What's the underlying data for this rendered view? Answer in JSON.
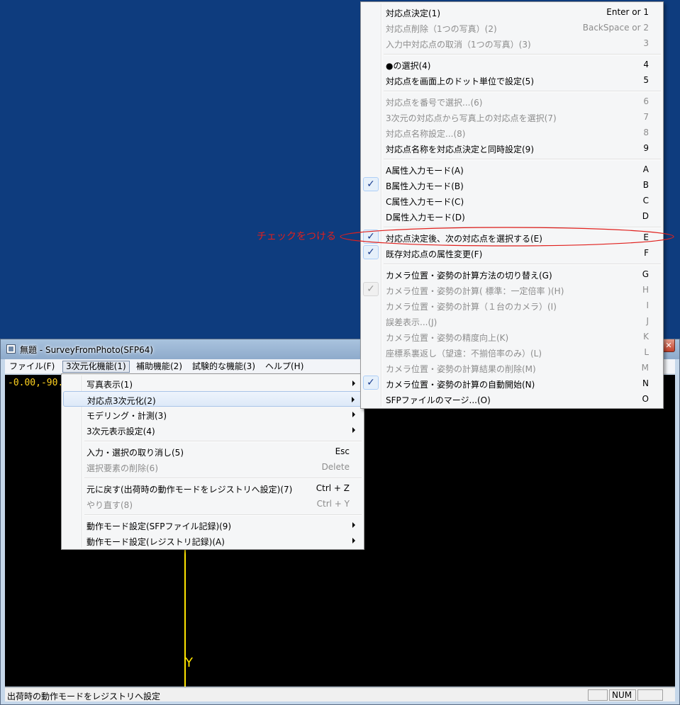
{
  "window": {
    "title": "無題 - SurveyFromPhoto(SFP64)",
    "close_label": "✕"
  },
  "menubar": {
    "items": [
      {
        "label": "ファイル(F)"
      },
      {
        "label": "3次元化機能(1)"
      },
      {
        "label": "補助機能(2)"
      },
      {
        "label": "試験的な機能(3)"
      },
      {
        "label": "ヘルプ(H)"
      }
    ]
  },
  "canvas": {
    "coord_readout": "-0.00,-90.",
    "axis_label": "Y",
    "line_color": "#ffe400"
  },
  "statusbar": {
    "text": "出荷時の動作モードをレジストリへ設定",
    "num_label": "NUM"
  },
  "main_menu": {
    "items": [
      {
        "label": "写真表示(1)",
        "submenu": true
      },
      {
        "label": "対応点3次元化(2)",
        "submenu": true
      },
      {
        "label": "モデリング・計測(3)",
        "submenu": true
      },
      {
        "label": "3次元表示設定(4)",
        "submenu": true
      },
      {
        "label": "入力・選択の取り消し(5)",
        "shortcut": "Esc"
      },
      {
        "label": "選択要素の削除(6)",
        "shortcut": "Delete"
      },
      {
        "label": "元に戻す(出荷時の動作モードをレジストリへ設定)(7)",
        "shortcut": "Ctrl + Z"
      },
      {
        "label": "やり直す(8)",
        "shortcut": "Ctrl + Y"
      },
      {
        "label": "動作モード設定(SFPファイル記録)(9)",
        "submenu": true
      },
      {
        "label": "動作モード設定(レジストリ記録)(A)",
        "submenu": true
      }
    ]
  },
  "sub_menu": {
    "items": [
      {
        "label": "対応点決定(1)",
        "shortcut": "Enter or 1"
      },
      {
        "label": "対応点削除（1つの写真）(2)",
        "shortcut": "BackSpace or 2"
      },
      {
        "label": "入力中対応点の取消（1つの写真）(3)",
        "shortcut": "3"
      },
      {
        "label": "●の選択(4)",
        "shortcut": "4"
      },
      {
        "label": "対応点を画面上のドット単位で設定(5)",
        "shortcut": "5"
      },
      {
        "label": "対応点を番号で選択...(6)",
        "shortcut": "6"
      },
      {
        "label": "3次元の対応点から写真上の対応点を選択(7)",
        "shortcut": "7"
      },
      {
        "label": "対応点名称設定...(8)",
        "shortcut": "8"
      },
      {
        "label": "対応点名称を対応点決定と同時設定(9)",
        "shortcut": "9"
      },
      {
        "label": "A属性入力モード(A)",
        "shortcut": "A"
      },
      {
        "label": "B属性入力モード(B)",
        "shortcut": "B"
      },
      {
        "label": "C属性入力モード(C)",
        "shortcut": "C"
      },
      {
        "label": "D属性入力モード(D)",
        "shortcut": "D"
      },
      {
        "label": "対応点決定後、次の対応点を選択する(E)",
        "shortcut": "E"
      },
      {
        "label": "既存対応点の属性変更(F)",
        "shortcut": "F"
      },
      {
        "label": "カメラ位置・姿勢の計算方法の切り替え(G)",
        "shortcut": "G"
      },
      {
        "label": "カメラ位置・姿勢の計算( 標準：一定倍率 )(H)",
        "shortcut": "H"
      },
      {
        "label": "カメラ位置・姿勢の計算（１台のカメラ）(I)",
        "shortcut": "I"
      },
      {
        "label": "誤差表示...(J)",
        "shortcut": "J"
      },
      {
        "label": "カメラ位置・姿勢の精度向上(K)",
        "shortcut": "K"
      },
      {
        "label": "座標系裏返し（望遠：不揃倍率のみ）(L)",
        "shortcut": "L"
      },
      {
        "label": "カメラ位置・姿勢の計算結果の削除(M)",
        "shortcut": "M"
      },
      {
        "label": "カメラ位置・姿勢の計算の自動開始(N)",
        "shortcut": "N"
      },
      {
        "label": "SFPファイルのマージ...(O)",
        "shortcut": "O"
      }
    ],
    "check_glyph": "✓"
  },
  "annotation": {
    "text": "チェックをつける",
    "color": "#e0201d"
  }
}
